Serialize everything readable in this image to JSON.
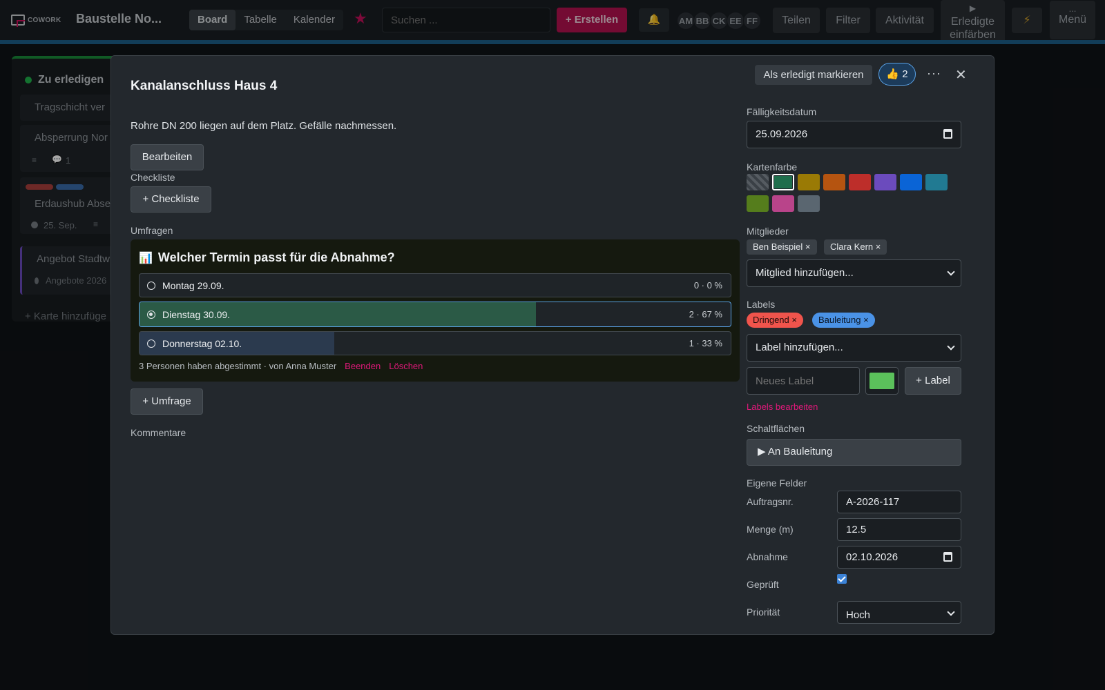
{
  "topbar": {
    "logo_text": "COWORK",
    "board_title": "Baustelle No...",
    "tabs": [
      "Board",
      "Tabelle",
      "Kalender"
    ],
    "active_tab": "Board",
    "search_placeholder": "Suchen ...",
    "create_label": "+ Erstellen",
    "avatars": [
      "AM",
      "BB",
      "CK",
      "EE",
      "FF"
    ],
    "share_label": "Teilen",
    "filter_label": "Filter",
    "activity_label": "Aktivität",
    "color_done_label_1": "Erledigte",
    "color_done_label_2": "einfärben",
    "menu_label": "Menü",
    "menu_dots": "...",
    "play_icon": "▶",
    "bolt_icon": "⚡",
    "bell_icon": "🔔",
    "star_icon": "★"
  },
  "board": {
    "column_title": "Zu erledigen",
    "cards": [
      {
        "title": "Tragschicht ver"
      },
      {
        "title": "Absperrung Nor",
        "comments": "1"
      },
      {
        "title": "Erdaushub Abse",
        "date": "25. Sep."
      },
      {
        "title": "Angebot Stadtw",
        "tag": "Angebote 2026"
      }
    ],
    "add_card_label": "+ Karte hinzufüge"
  },
  "modal": {
    "title": "Kanalanschluss Haus 4",
    "description": "Rohre DN 200 liegen auf dem Platz. Gefälle nachmessen.",
    "edit_label": "Bearbeiten",
    "checklist_heading": "Checkliste",
    "add_checklist_label": "+ Checkliste",
    "polls_heading": "Umfragen",
    "poll": {
      "question": "Welcher Termin passt für die Abnahme?",
      "icon": "📊",
      "options": [
        {
          "label": "Montag 29.09.",
          "votes": 0,
          "percent": 0,
          "count_text": "0 · 0 %",
          "selected": false,
          "color": "#1f2428"
        },
        {
          "label": "Dienstag 30.09.",
          "votes": 2,
          "percent": 67,
          "count_text": "2 · 67 %",
          "selected": true,
          "color": "#2b5a46"
        },
        {
          "label": "Donnerstag 02.10.",
          "votes": 1,
          "percent": 33,
          "count_text": "1 · 33 %",
          "selected": false,
          "color": "#2b3a4e"
        }
      ],
      "footer": "3 Personen haben abgestimmt · von Anna Muster",
      "end_label": "Beenden",
      "delete_label": "Löschen"
    },
    "add_poll_label": "+ Umfrage",
    "comments_heading": "Kommentare",
    "mark_done_label": "Als erledigt markieren",
    "thumb_icon": "👍",
    "thumb_count": "2",
    "more_icon": "···",
    "close_icon": "✕",
    "due": {
      "heading": "Fälligkeitsdatum",
      "value": "25.09.2026"
    },
    "card_color": {
      "heading": "Kartenfarbe",
      "swatches": [
        "none",
        "#1f6e4c",
        "#9a7a05",
        "#b55410",
        "#bd2e2a",
        "#6b4bbd",
        "#0a64d6",
        "#217a92",
        "#557d1c",
        "#b9448a",
        "#5a6670"
      ],
      "selected": "#1f6e4c"
    },
    "members": {
      "heading": "Mitglieder",
      "list": [
        "Ben Beispiel",
        "Clara Kern"
      ],
      "add_placeholder": "Mitglied hinzufügen..."
    },
    "labels": {
      "heading": "Labels",
      "list": [
        {
          "name": "Dringend",
          "color": "#f0544c"
        },
        {
          "name": "Bauleitung",
          "color": "#4a92e6"
        }
      ],
      "add_placeholder": "Label hinzufügen...",
      "new_label_placeholder": "Neues Label",
      "new_label_color": "#5bc15b",
      "add_label_button": "+ Label",
      "edit_labels_link": "Labels bearbeiten"
    },
    "buttons": {
      "heading": "Schaltflächen",
      "items": [
        "▶ An Bauleitung"
      ]
    },
    "custom_fields": {
      "heading": "Eigene Felder",
      "fields": [
        {
          "label": "Auftragsnr.",
          "value": "A-2026-117"
        },
        {
          "label": "Menge (m)",
          "value": "12.5"
        },
        {
          "label": "Abnahme",
          "value": "02.10.2026"
        },
        {
          "label": "Geprüft",
          "value": "checked"
        },
        {
          "label": "Priorität",
          "value": "Hoch"
        }
      ]
    }
  }
}
